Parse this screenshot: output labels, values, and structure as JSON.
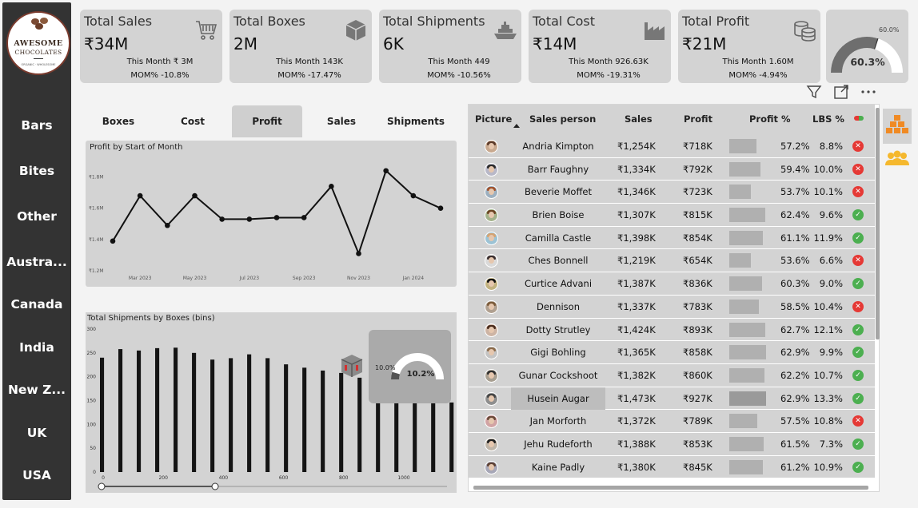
{
  "brand": {
    "line1": "AWESOME",
    "line2": "CHOCOLATES",
    "tagline": "ORGANIC · WHOLESOME"
  },
  "nav": [
    "Bars",
    "Bites",
    "Other",
    "Austra...",
    "Canada",
    "India",
    "New Z...",
    "UK",
    "USA"
  ],
  "kpis": [
    {
      "title": "Total Sales",
      "value": "₹34M",
      "this_month": "This Month ₹ 3M",
      "mom": "MOM% -10.8%",
      "icon": "cart-icon"
    },
    {
      "title": "Total Boxes",
      "value": "2M",
      "this_month": "This Month 143K",
      "mom": "MOM% -17.47%",
      "icon": "box-icon"
    },
    {
      "title": "Total Shipments",
      "value": "6K",
      "this_month": "This Month 449",
      "mom": "MOM% -10.56%",
      "icon": "ship-icon"
    },
    {
      "title": "Total Cost",
      "value": "₹14M",
      "this_month": "This Month 926.63K",
      "mom": "MOM% -19.31%",
      "icon": "factory-icon"
    },
    {
      "title": "Total Profit",
      "value": "₹21M",
      "this_month": "This Month 1.60M",
      "mom": "MOM% -4.94%",
      "icon": "coins-icon"
    }
  ],
  "profit_gauge": {
    "value_label": "60.3%",
    "target_label": "60.0%",
    "value": 60.3,
    "target": 60.0
  },
  "tabs": [
    {
      "label": "Boxes",
      "active": false
    },
    {
      "label": "Cost",
      "active": false
    },
    {
      "label": "Profit",
      "active": true
    },
    {
      "label": "Sales",
      "active": false
    },
    {
      "label": "Shipments",
      "active": false
    }
  ],
  "line_chart_title": "Profit by Start of Month",
  "hist_title": "Total Shipments by Boxes (bins)",
  "shipment_gauge": {
    "value_label": "10.2%",
    "target_label": "10.0%",
    "value": 10.2,
    "target": 10.0
  },
  "chart_data": [
    {
      "type": "line",
      "title": "Profit by Start of Month",
      "x": [
        "Feb 2023",
        "Mar 2023",
        "Apr 2023",
        "May 2023",
        "Jun 2023",
        "Jul 2023",
        "Aug 2023",
        "Sep 2023",
        "Oct 2023",
        "Nov 2023",
        "Dec 2023",
        "Jan 2024",
        "Feb 2024"
      ],
      "x_tick_labels": [
        "Mar 2023",
        "May 2023",
        "Jul 2023",
        "Sep 2023",
        "Nov 2023",
        "Jan 2024"
      ],
      "y_tick_labels": [
        "₹1.2M",
        "₹1.4M",
        "₹1.6M",
        "₹1.8M"
      ],
      "values": [
        1.39,
        1.68,
        1.49,
        1.68,
        1.53,
        1.53,
        1.54,
        1.54,
        1.74,
        1.31,
        1.84,
        1.68,
        1.6
      ],
      "ylim": [
        1.2,
        1.9
      ],
      "grid": false
    },
    {
      "type": "bar",
      "title": "Total Shipments by Boxes (bins)",
      "bin_width": 10,
      "x_start": 0,
      "values": [
        240,
        258,
        255,
        260,
        261,
        250,
        236,
        239,
        247,
        239,
        226,
        219,
        213,
        208,
        198,
        195,
        183,
        168,
        165,
        146,
        150,
        148,
        122,
        128,
        116,
        107,
        118,
        91,
        100,
        96,
        68,
        71,
        75,
        78,
        56,
        68,
        55,
        57,
        44,
        47,
        44,
        40,
        38,
        35,
        28,
        38,
        33,
        27,
        27,
        25,
        22,
        22,
        20,
        20,
        20,
        20,
        16,
        12,
        16,
        12,
        14,
        12,
        11,
        12,
        10,
        9,
        9,
        6,
        8,
        9,
        5,
        8,
        6,
        6,
        6,
        8
      ],
      "x_ticks": [
        0,
        200,
        400,
        600,
        800,
        1000
      ],
      "y_ticks": [
        0,
        50,
        100,
        150,
        200,
        250,
        300
      ],
      "ylim": [
        0,
        300
      ]
    }
  ],
  "table": {
    "headers": [
      "Picture",
      "Sales person",
      "Sales",
      "Profit",
      "Profit %",
      "LBS %"
    ],
    "rows": [
      {
        "name": "Andria Kimpton",
        "sales": "₹1,254K",
        "profit": "₹718K",
        "profit_pct": "57.2%",
        "lbs": "8.8%",
        "ok": false
      },
      {
        "name": "Barr Faughny",
        "sales": "₹1,334K",
        "profit": "₹792K",
        "profit_pct": "59.4%",
        "lbs": "10.0%",
        "ok": false
      },
      {
        "name": "Beverie Moffet",
        "sales": "₹1,346K",
        "profit": "₹723K",
        "profit_pct": "53.7%",
        "lbs": "10.1%",
        "ok": false
      },
      {
        "name": "Brien Boise",
        "sales": "₹1,307K",
        "profit": "₹815K",
        "profit_pct": "62.4%",
        "lbs": "9.6%",
        "ok": true
      },
      {
        "name": "Camilla Castle",
        "sales": "₹1,398K",
        "profit": "₹854K",
        "profit_pct": "61.1%",
        "lbs": "11.9%",
        "ok": true
      },
      {
        "name": "Ches Bonnell",
        "sales": "₹1,219K",
        "profit": "₹654K",
        "profit_pct": "53.6%",
        "lbs": "6.6%",
        "ok": false
      },
      {
        "name": "Curtice Advani",
        "sales": "₹1,387K",
        "profit": "₹836K",
        "profit_pct": "60.3%",
        "lbs": "9.0%",
        "ok": true
      },
      {
        "name": "Dennison Crosswaite",
        "sales": "₹1,337K",
        "profit": "₹783K",
        "profit_pct": "58.5%",
        "lbs": "10.4%",
        "ok": false
      },
      {
        "name": "Dotty Strutley",
        "sales": "₹1,424K",
        "profit": "₹893K",
        "profit_pct": "62.7%",
        "lbs": "12.1%",
        "ok": true
      },
      {
        "name": "Gigi Bohling",
        "sales": "₹1,365K",
        "profit": "₹858K",
        "profit_pct": "62.9%",
        "lbs": "9.9%",
        "ok": true
      },
      {
        "name": "Gunar Cockshoot",
        "sales": "₹1,382K",
        "profit": "₹860K",
        "profit_pct": "62.2%",
        "lbs": "10.7%",
        "ok": true
      },
      {
        "name": "Husein Augar",
        "sales": "₹1,473K",
        "profit": "₹927K",
        "profit_pct": "62.9%",
        "lbs": "13.3%",
        "ok": true,
        "highlight": true
      },
      {
        "name": "Jan Morforth",
        "sales": "₹1,372K",
        "profit": "₹789K",
        "profit_pct": "57.5%",
        "lbs": "10.8%",
        "ok": false
      },
      {
        "name": "Jehu Rudeforth",
        "sales": "₹1,388K",
        "profit": "₹853K",
        "profit_pct": "61.5%",
        "lbs": "7.3%",
        "ok": true
      },
      {
        "name": "Kaine Padly",
        "sales": "₹1,380K",
        "profit": "₹845K",
        "profit_pct": "61.2%",
        "lbs": "10.9%",
        "ok": true
      }
    ]
  },
  "colors": {
    "sidebar": "#333333",
    "card": "#d3d3d3",
    "ok": "#4caf50",
    "bad": "#e53935",
    "accent_orange": "#f08a24",
    "accent_yellow": "#f5b82e"
  }
}
